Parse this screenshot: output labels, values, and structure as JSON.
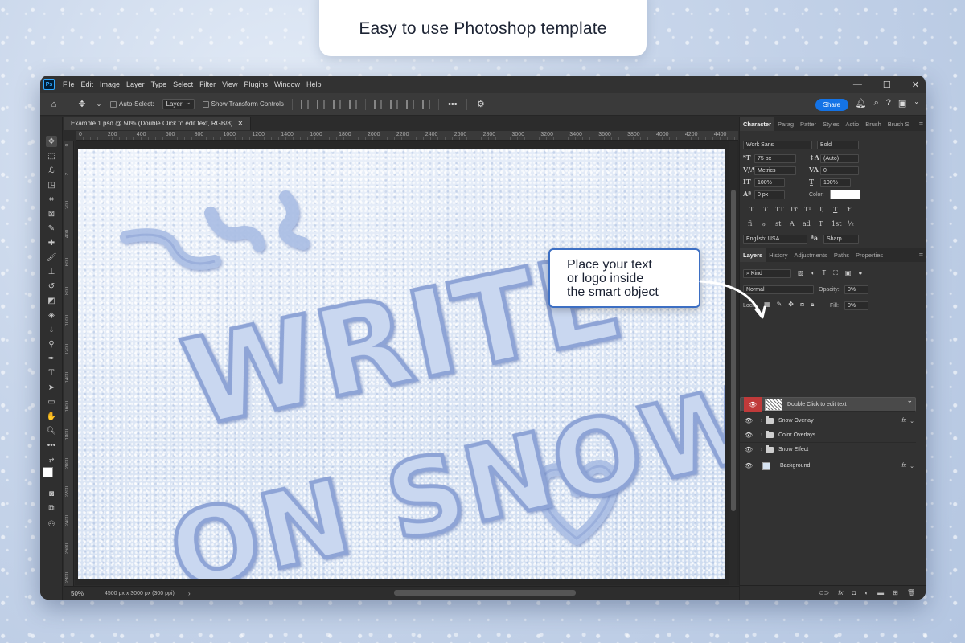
{
  "banner": {
    "title": "Easy to use Photoshop template"
  },
  "app": {
    "logo": "Ps",
    "menus": [
      "File",
      "Edit",
      "Image",
      "Layer",
      "Type",
      "Select",
      "Filter",
      "View",
      "Plugins",
      "Window",
      "Help"
    ],
    "window_controls": [
      "—",
      "☐",
      "✕"
    ]
  },
  "options_bar": {
    "auto_select_label": "Auto-Select:",
    "auto_select_value": "Layer",
    "show_transform_label": "Show Transform Controls",
    "share_label": "Share"
  },
  "document": {
    "tab_title": "Example 1.psd @ 50% (Double Click to edit text, RGB/8)",
    "ruler_h": [
      "0",
      "200",
      "400",
      "600",
      "800",
      "1000",
      "1200",
      "1400",
      "1600",
      "1800",
      "2000",
      "2200",
      "2400",
      "2600",
      "2800",
      "3000",
      "3200",
      "3400",
      "3600",
      "3800",
      "4000",
      "4200",
      "4400"
    ],
    "ruler_v": [
      "0",
      "2",
      "200",
      "400",
      "600",
      "800",
      "1000",
      "1200",
      "1400",
      "1600",
      "1800",
      "2000",
      "2200",
      "2400",
      "2600",
      "2800"
    ],
    "artwork_text": [
      "WRITE",
      "ON SNOW"
    ],
    "zoom": "50%",
    "info": "4500 px x 3000 px (300 ppi)"
  },
  "character_panel": {
    "tabs": [
      "Character",
      "Parag",
      "Patter",
      "Styles",
      "Actio",
      "Brush",
      "Brush S"
    ],
    "font_family": "Work Sans",
    "font_style": "Bold",
    "font_size": "75 px",
    "leading": "(Auto)",
    "kerning": "Metrics",
    "tracking": "0",
    "vscale": "100%",
    "hscale": "100%",
    "baseline": "0 px",
    "color_label": "Color:",
    "text_styles": [
      "T",
      "T",
      "TT",
      "Tт",
      "T¹",
      "T,",
      "T",
      "Ŧ"
    ],
    "ot_features": [
      "fi",
      "ℴ",
      "st",
      "A",
      "ad",
      "T",
      "1st",
      "½"
    ],
    "language": "English: USA",
    "antialias_icon": "ªa",
    "antialias": "Sharp"
  },
  "layers_panel": {
    "tabs": [
      "Layers",
      "History",
      "Adjustments",
      "Paths",
      "Properties"
    ],
    "filter_kind": "Kind",
    "blend_mode": "Normal",
    "opacity_label": "Opacity:",
    "opacity_value": "0%",
    "lock_label": "Lock:",
    "fill_label": "Fill:",
    "fill_value": "0%",
    "layers": [
      {
        "name": "Double Click to edit text",
        "type": "smart",
        "selected": true,
        "fx": false
      },
      {
        "name": "Snow Overlay",
        "type": "group",
        "selected": false,
        "fx": true
      },
      {
        "name": "Color Overlays",
        "type": "group",
        "selected": false,
        "fx": false
      },
      {
        "name": "Snow Effect",
        "type": "group",
        "selected": false,
        "fx": false
      },
      {
        "name": "Background",
        "type": "image",
        "selected": false,
        "fx": true
      }
    ]
  },
  "callout": {
    "lines": [
      "Place your text",
      "or logo inside",
      "the smart object"
    ]
  },
  "colors": {
    "accent": "#1473e6",
    "callout_border": "#3d6fc3",
    "snow_ink": "#8ea4d6"
  }
}
